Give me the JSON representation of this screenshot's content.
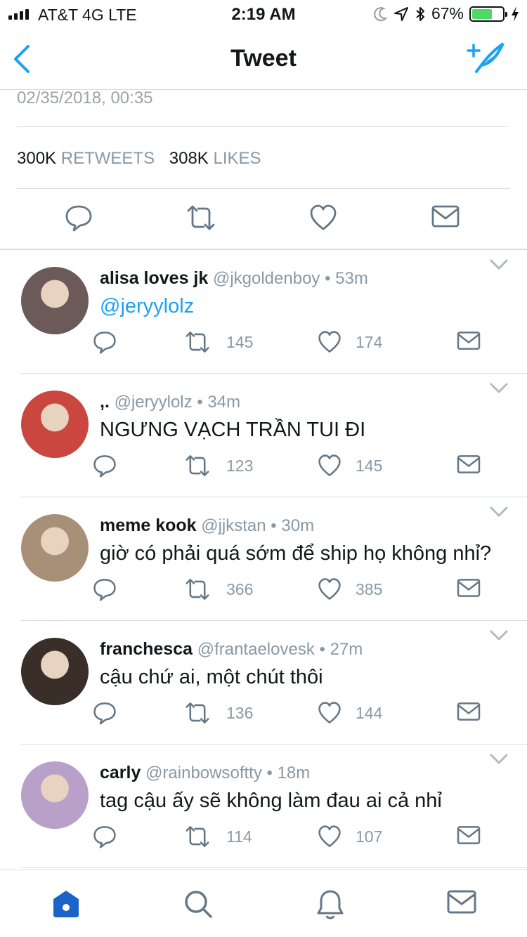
{
  "status_bar": {
    "carrier": "AT&T 4G  LTE",
    "time": "2:19 AM",
    "battery_percent": "67%",
    "battery_level": 0.67
  },
  "nav": {
    "title": "Tweet",
    "back_icon": "chevron-left-icon",
    "compose_icon": "compose-tweet-icon"
  },
  "tweet": {
    "timestamp": "02/35/2018, 00:35",
    "retweets_count": "300K",
    "retweets_label": "RETWEETS",
    "likes_count": "308K",
    "likes_label": "LIKES"
  },
  "replies": [
    {
      "name": "alisa loves jk",
      "handle": "@jkgoldenboy",
      "time": "53m",
      "text": "@jeryylolz",
      "is_link": true,
      "retweets": "145",
      "likes": "174",
      "avatar_color": "#6b5a58"
    },
    {
      "name": ",.",
      "handle": "@jeryylolz",
      "time": "34m",
      "text": "NGƯNG VẠCH TRẦN TUI ĐI",
      "is_link": false,
      "retweets": "123",
      "likes": "145",
      "avatar_color": "#c9473f"
    },
    {
      "name": "meme kook",
      "handle": "@jjkstan",
      "time": "30m",
      "text": "giờ có phải quá sớm để ship họ không nhỉ?",
      "is_link": false,
      "retweets": "366",
      "likes": "385",
      "avatar_color": "#a89078"
    },
    {
      "name": "franchesca",
      "handle": "@frantaelovesk",
      "time": "27m",
      "text": "cậu chứ ai, một chút thôi",
      "is_link": false,
      "retweets": "136",
      "likes": "144",
      "avatar_color": "#3a2e28"
    },
    {
      "name": "carly",
      "handle": "@rainbowsoftty",
      "time": "18m",
      "text": "tag cậu ấy sẽ không làm đau ai cả nhỉ",
      "is_link": false,
      "retweets": "114",
      "likes": "107",
      "avatar_color": "#b9a0c8"
    }
  ],
  "tabbar": {
    "items": [
      "home-icon",
      "search-icon",
      "notifications-icon",
      "messages-icon"
    ],
    "active": "home-icon"
  },
  "colors": {
    "accent": "#1da1f2",
    "secondary_text": "#8899a6",
    "icon": "#657786",
    "tab_active": "#1b64c7"
  }
}
